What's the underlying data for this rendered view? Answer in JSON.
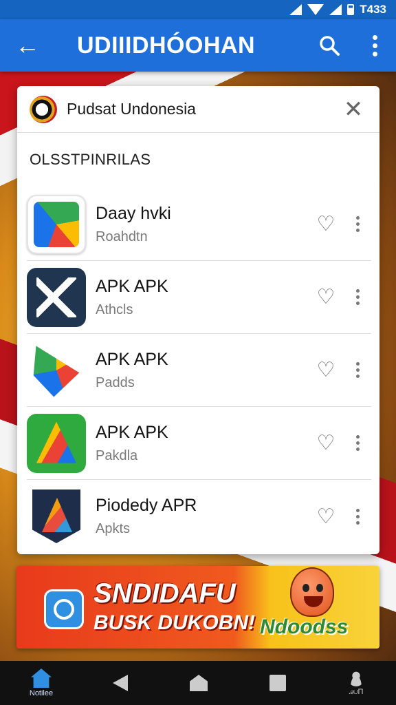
{
  "status_bar": {
    "time": "T433"
  },
  "app_bar": {
    "back_icon": "arrow-left-icon",
    "title": "UDIIIDHÓOHAN",
    "search_icon": "search-icon",
    "menu_icon": "more-vertical-icon"
  },
  "card": {
    "title": "Pudsat Undonesia",
    "close_icon": "close-icon",
    "section_label": "OLSSTPINRILAS",
    "items": [
      {
        "title": "Daay hvki",
        "subtitle": "Roahdtn",
        "icon": "app-icon-drive"
      },
      {
        "title": "APK APK",
        "subtitle": "Athcls",
        "icon": "app-icon-av"
      },
      {
        "title": "APK APK",
        "subtitle": "Padds",
        "icon": "app-icon-play"
      },
      {
        "title": "APK APK",
        "subtitle": "Pakdla",
        "icon": "app-icon-triangle"
      },
      {
        "title": "Piodedy APR",
        "subtitle": "Apkts",
        "icon": "app-icon-shield"
      }
    ]
  },
  "banner": {
    "line1": "SNDIDAFU",
    "line2": "BUSK DUKOBN!",
    "brand": "Ndoodss"
  },
  "nav": {
    "home_label": "Notilee",
    "profile_label": "ꭿ∪П"
  },
  "colors": {
    "app_bar": "#1e6fd9",
    "status_bar": "#1565c0",
    "banner_red": "#e83a1c",
    "banner_yellow": "#f9d33b"
  }
}
